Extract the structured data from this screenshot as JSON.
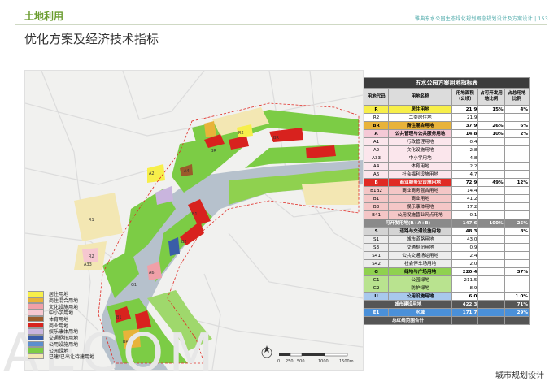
{
  "header": {
    "section": "土地利用",
    "page_header": "雅典东水公园生态绿化规划概念规划设计及方案设计 | 153"
  },
  "title": "优化方案及经济技术指标",
  "watermark": "AECOM",
  "map": {
    "scale_labels": [
      "0",
      "250",
      "500",
      "1000",
      "1500m"
    ],
    "legend": [
      {
        "label": "居住用地",
        "color": "#f7ef4a"
      },
      {
        "label": "商住混合用地",
        "color": "#e8b33a"
      },
      {
        "label": "文化设施用地",
        "color": "#f0a0a8"
      },
      {
        "label": "中小学用地",
        "color": "#f6c7d0"
      },
      {
        "label": "体育用地",
        "color": "#9a5a2a"
      },
      {
        "label": "商业用地",
        "color": "#d8221e"
      },
      {
        "label": "娱乐康体用地",
        "color": "#c9b5de"
      },
      {
        "label": "交通枢纽用地",
        "color": "#3a5da8"
      },
      {
        "label": "公用设施用地",
        "color": "#5c8fcf"
      },
      {
        "label": "公园绿地",
        "color": "#7ccc45"
      },
      {
        "label": "已建/已出让待建用地",
        "color": "#f3e7b3"
      }
    ],
    "block_labels": [
      "R1",
      "R2",
      "BR",
      "A2",
      "A4",
      "A33",
      "B1",
      "B2",
      "G1",
      "BR",
      "R2",
      "A6",
      "B1",
      "BR"
    ]
  },
  "table": {
    "title": "五水公园方案用地指标表",
    "headers": [
      "用地代码",
      "用地名称",
      "用地面积（公顷）",
      "占可开发用地比例",
      "占总用地比例"
    ],
    "rows": [
      {
        "code": "R",
        "name": "居住用地",
        "area": "21.9",
        "pct_dev": "15%",
        "pct_total": "4%",
        "bg": "#f7ef4a",
        "bold": true
      },
      {
        "code": "R2",
        "name": "二类居住地",
        "area": "21.9",
        "pct_dev": "",
        "pct_total": "",
        "bg": "#ffffff",
        "bold": false
      },
      {
        "code": "BR",
        "name": "商住混合用地",
        "area": "37.9",
        "pct_dev": "26%",
        "pct_total": "6%",
        "bg": "#e8b33a",
        "bold": true
      },
      {
        "code": "A",
        "name": "公共管理与公共服务用地",
        "area": "14.8",
        "pct_dev": "10%",
        "pct_total": "2%",
        "bg": "#f5c9d6",
        "bold": true
      },
      {
        "code": "A1",
        "name": "行政管理用地",
        "area": "0.4",
        "pct_dev": "",
        "pct_total": "",
        "bg": "#fbe6ec",
        "bold": false
      },
      {
        "code": "A2",
        "name": "文化设施用地",
        "area": "2.8",
        "pct_dev": "",
        "pct_total": "",
        "bg": "#fbe6ec",
        "bold": false
      },
      {
        "code": "A33",
        "name": "中小学用地",
        "area": "4.8",
        "pct_dev": "",
        "pct_total": "",
        "bg": "#fbe6ec",
        "bold": false
      },
      {
        "code": "A4",
        "name": "体育用地",
        "area": "2.2",
        "pct_dev": "",
        "pct_total": "",
        "bg": "#fbe6ec",
        "bold": false
      },
      {
        "code": "A6",
        "name": "社会福利设施用地",
        "area": "4.7",
        "pct_dev": "",
        "pct_total": "",
        "bg": "#fbe6ec",
        "bold": false
      },
      {
        "code": "B",
        "name": "商业服务业设施用地",
        "area": "72.9",
        "pct_dev": "49%",
        "pct_total": "12%",
        "bg": "#e02a24",
        "bold": true
      },
      {
        "code": "B1B2",
        "name": "商业商务混合用地",
        "area": "14.4",
        "pct_dev": "",
        "pct_total": "",
        "bg": "#f4c6c6",
        "bold": false
      },
      {
        "code": "B1",
        "name": "商业用地",
        "area": "41.2",
        "pct_dev": "",
        "pct_total": "",
        "bg": "#f4c6c6",
        "bold": false
      },
      {
        "code": "B3",
        "name": "娱乐康体用地",
        "area": "17.2",
        "pct_dev": "",
        "pct_total": "",
        "bg": "#f4c6c6",
        "bold": false
      },
      {
        "code": "B41",
        "name": "公用设施营业网点用地",
        "area": "0.1",
        "pct_dev": "",
        "pct_total": "",
        "bg": "#f4c6c6",
        "bold": false
      },
      {
        "code": "",
        "name": "可开发用地(R+A+B)",
        "area": "147.6",
        "pct_dev": "100%",
        "pct_total": "25%",
        "bg": "#8a8a8a",
        "bold": true,
        "merged": true
      },
      {
        "code": "S",
        "name": "道路与交通设施用地",
        "area": "48.3",
        "pct_dev": "",
        "pct_total": "8%",
        "bg": "#d4d4d4",
        "bold": true
      },
      {
        "code": "S1",
        "name": "城市道路用地",
        "area": "43.0",
        "pct_dev": "",
        "pct_total": "",
        "bg": "#ececec",
        "bold": false
      },
      {
        "code": "S3",
        "name": "交通枢纽用地",
        "area": "0.9",
        "pct_dev": "",
        "pct_total": "",
        "bg": "#ececec",
        "bold": false
      },
      {
        "code": "S41",
        "name": "公共交通场站用地",
        "area": "2.4",
        "pct_dev": "",
        "pct_total": "",
        "bg": "#ececec",
        "bold": false
      },
      {
        "code": "S42",
        "name": "社会停车场用地",
        "area": "2.0",
        "pct_dev": "",
        "pct_total": "",
        "bg": "#ececec",
        "bold": false
      },
      {
        "code": "G",
        "name": "绿地与广场用地",
        "area": "220.4",
        "pct_dev": "",
        "pct_total": "37%",
        "bg": "#8fd14f",
        "bold": true
      },
      {
        "code": "G1",
        "name": "公园绿地",
        "area": "211.5",
        "pct_dev": "",
        "pct_total": "",
        "bg": "#b9e38f",
        "bold": false
      },
      {
        "code": "G2",
        "name": "防护绿地",
        "area": "8.9",
        "pct_dev": "",
        "pct_total": "",
        "bg": "#b9e38f",
        "bold": false
      },
      {
        "code": "U",
        "name": "公用设施用地",
        "area": "6.0",
        "pct_dev": "",
        "pct_total": "1.0%",
        "bg": "#a8c8ec",
        "bold": true
      },
      {
        "code": "",
        "name": "城市建设用地",
        "area": "422.3",
        "pct_dev": "",
        "pct_total": "71%",
        "bg": "#555555",
        "bold": true,
        "merged": true,
        "sum": true
      },
      {
        "code": "E1",
        "name": "水域",
        "area": "171.7",
        "pct_dev": "",
        "pct_total": "29%",
        "bg": "#4a90d9",
        "bold": true
      },
      {
        "code": "",
        "name": "总红线范围合计",
        "area": "",
        "pct_dev": "",
        "pct_total": "",
        "bg": "#555555",
        "bold": true,
        "merged": true,
        "sum": true
      }
    ]
  },
  "footer": "城市规划设计"
}
